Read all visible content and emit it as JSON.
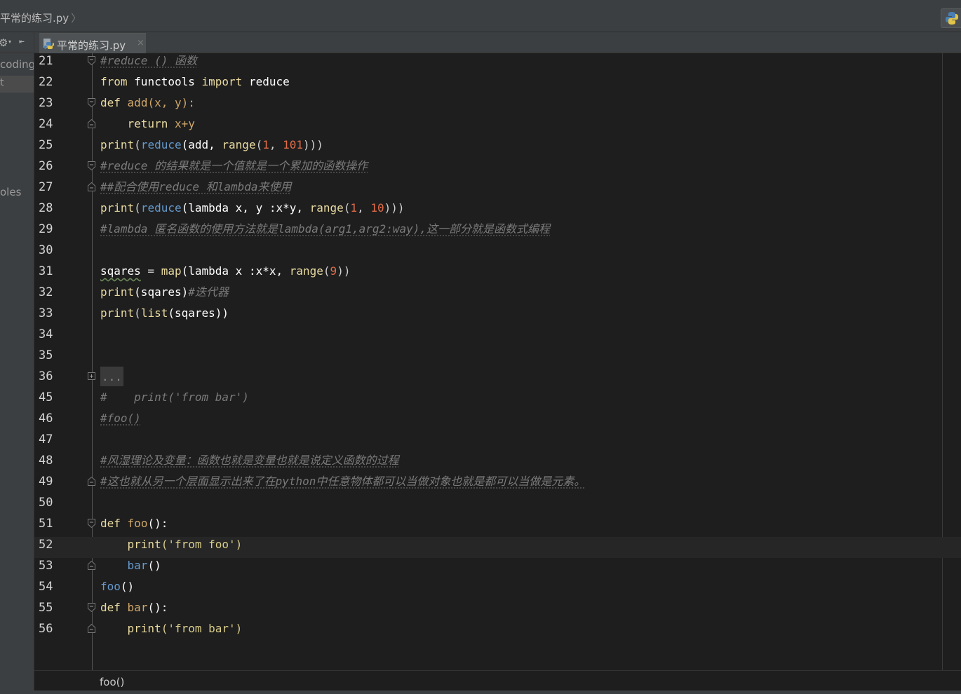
{
  "navbar": {
    "breadcrumb": "平常的练习.py",
    "breadcrumb_arrow": "〉"
  },
  "project_panel": {
    "tree_items": [
      "coding",
      "oles"
    ],
    "selected_item": "t"
  },
  "tabs": [
    {
      "label": "平常的练习.py",
      "close": "×",
      "icon": "python-file-icon"
    }
  ],
  "editor": {
    "lines": [
      {
        "num": "21",
        "fold": "start"
      },
      {
        "num": "22",
        "fold": ""
      },
      {
        "num": "23",
        "fold": "start"
      },
      {
        "num": "24",
        "fold": "end"
      },
      {
        "num": "25",
        "fold": ""
      },
      {
        "num": "26",
        "fold": "start"
      },
      {
        "num": "27",
        "fold": "end"
      },
      {
        "num": "28",
        "fold": ""
      },
      {
        "num": "29",
        "fold": ""
      },
      {
        "num": "30",
        "fold": ""
      },
      {
        "num": "31",
        "fold": ""
      },
      {
        "num": "32",
        "fold": ""
      },
      {
        "num": "33",
        "fold": ""
      },
      {
        "num": "34",
        "fold": ""
      },
      {
        "num": "35",
        "fold": ""
      },
      {
        "num": "36",
        "fold": "collapsed"
      },
      {
        "num": "45",
        "fold": ""
      },
      {
        "num": "46",
        "fold": ""
      },
      {
        "num": "47",
        "fold": ""
      },
      {
        "num": "48",
        "fold": ""
      },
      {
        "num": "49",
        "fold": "end"
      },
      {
        "num": "50",
        "fold": ""
      },
      {
        "num": "51",
        "fold": "start"
      },
      {
        "num": "52",
        "fold": "",
        "current": true
      },
      {
        "num": "53",
        "fold": "end"
      },
      {
        "num": "54",
        "fold": ""
      },
      {
        "num": "55",
        "fold": "start"
      },
      {
        "num": "56",
        "fold": "end"
      }
    ],
    "code": {
      "l21": "#reduce () 函数",
      "l22_from": "from",
      "l22_mod": "functools",
      "l22_import": "import",
      "l22_name": "reduce",
      "l23_def": "def",
      "l23_fn": "add",
      "l23_params": "(x, y):",
      "l24_return": "return",
      "l24_expr": "x+y",
      "l25_print": "print",
      "l25_reduce": "reduce",
      "l25_add": "(add, ",
      "l25_range": "range",
      "l25_a": "1",
      "l25_b": "101",
      "l25_close": ")))",
      "l26": "#reduce 的结果就是一个值就是一个累加的函数操作",
      "l27": "##配合使用reduce 和lambda来使用",
      "l28_print": "print",
      "l28_reduce": "reduce",
      "l28_lambda": "(lambda x, y :x*y, ",
      "l28_range": "range",
      "l28_a": "1",
      "l28_b": "10",
      "l28_close": ")))",
      "l29": "#lambda 匿名函数的使用方法就是lambda(arg1,arg2:way),这一部分就是函数式编程",
      "l31_var": "sqares",
      "l31_eq": " = ",
      "l31_map": "map",
      "l31_lambda": "(lambda x :x*x, ",
      "l31_range": "range",
      "l31_a": "9",
      "l31_close": "))",
      "l32_print": "print",
      "l32_arg": "(sqares)",
      "l32_cm": "#迭代器",
      "l33_print": "print",
      "l33_list": "list",
      "l33_arg": "(sqares))",
      "l36_fold": "...",
      "l45": "#    print('from bar')",
      "l46": "#foo()",
      "l48": "#风湿理论及变量：函数也就是变量也就是说定义函数的过程",
      "l49": "#这也就从另一个层面显示出来了在python中任意物体都可以当做对象也就是都可以当做是元素。",
      "l51_def": "def",
      "l51_fn": "foo",
      "l51_rest": "():",
      "l52_print": "print",
      "l52_str": "('from foo')",
      "l53_call": "bar",
      "l53_rest": "()",
      "l54_call": "foo",
      "l54_rest": "()",
      "l55_def": "def",
      "l55_fn": "bar",
      "l55_rest": "():",
      "l56_print": "print",
      "l56_str": "('from bar')"
    }
  },
  "statusbar": {
    "breadcrumb": "foo()"
  },
  "colors": {
    "editor_bg": "#1e1e1e",
    "chrome_bg": "#3c3f41",
    "comment": "#7a7a7a",
    "number": "#e06c4a",
    "builtin": "#6699cc"
  }
}
